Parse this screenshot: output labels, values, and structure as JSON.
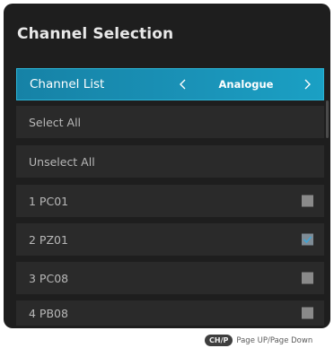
{
  "dialog": {
    "title": "Channel Selection"
  },
  "channel_list": {
    "label": "Channel List",
    "mode": "Analogue"
  },
  "actions": {
    "select_all": "Select All",
    "unselect_all": "Unselect All"
  },
  "channels": [
    {
      "name": "1 PC01",
      "checked": false
    },
    {
      "name": "2 PZ01",
      "checked": true
    },
    {
      "name": "3 PC08",
      "checked": false
    },
    {
      "name": "4 PB08",
      "checked": false
    }
  ],
  "footer": {
    "key_badge": "CH/P",
    "hint": "Page UP/Page Down"
  },
  "colors": {
    "panel": "#1e1e1e",
    "row": "#2a2a2a",
    "accent": "#1a93b8"
  }
}
